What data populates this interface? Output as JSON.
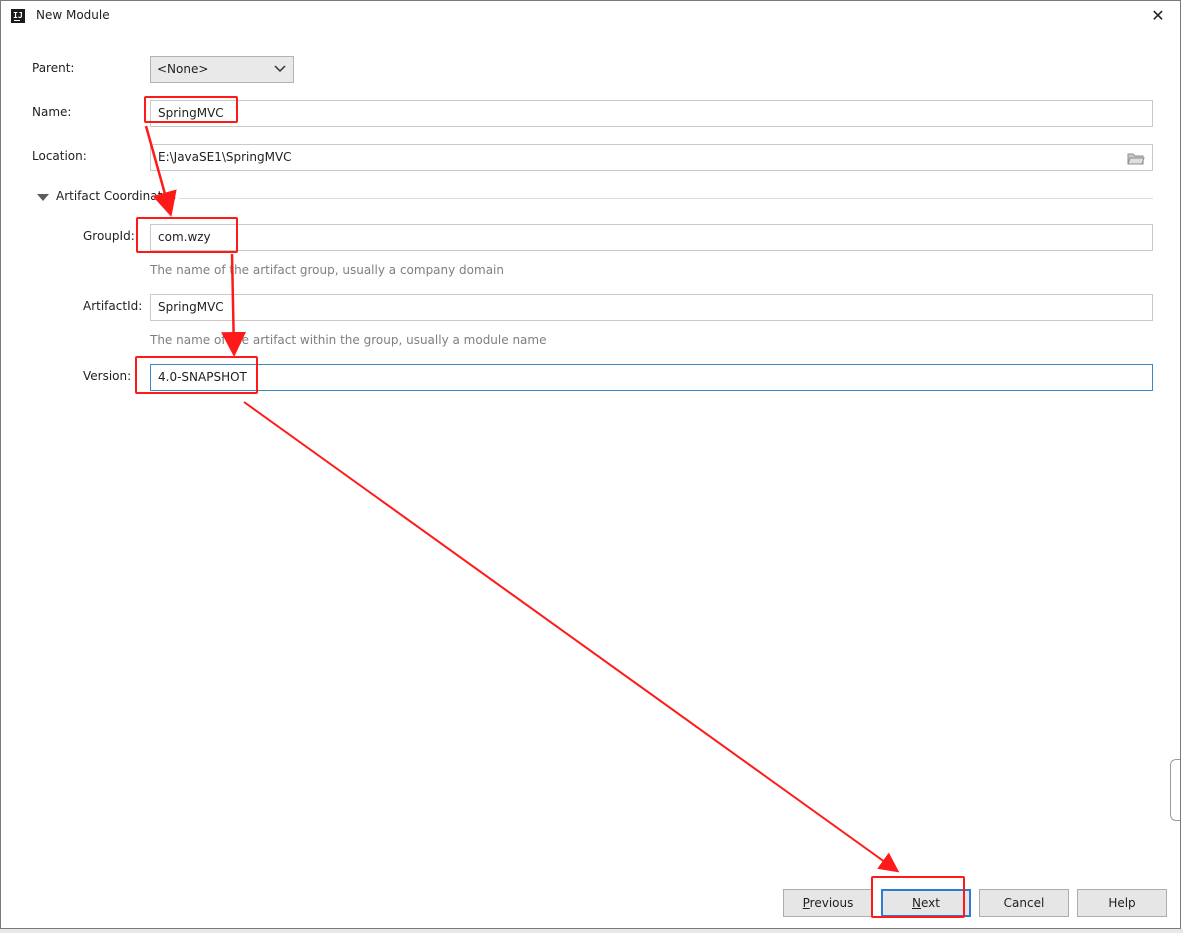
{
  "window": {
    "title": "New Module",
    "close_glyph": "✕",
    "app_icon_text": "IJ"
  },
  "form": {
    "parent": {
      "label": "Parent:",
      "value": "<None>"
    },
    "name": {
      "label": "Name:",
      "value": "SpringMVC"
    },
    "location": {
      "label": "Location:",
      "value": "E:\\JavaSE1\\SpringMVC"
    },
    "artifact_section": {
      "label": "Artifact Coordinates"
    },
    "group_id": {
      "label": "GroupId:",
      "value": "com.wzy",
      "hint": "The name of the artifact group, usually a company domain"
    },
    "artifact_id": {
      "label": "ArtifactId:",
      "value": "SpringMVC",
      "hint": "The name of the artifact within the group, usually a module name"
    },
    "version": {
      "label": "Version:",
      "value": "4.0-SNAPSHOT"
    }
  },
  "buttons": {
    "previous": {
      "mnemonic": "P",
      "rest": "revious"
    },
    "next": {
      "mnemonic": "N",
      "rest": "ext"
    },
    "cancel": "Cancel",
    "help": "Help"
  },
  "colors": {
    "annotation_red": "#ff1a1a",
    "focus_blue": "#3d87c3",
    "default_button_blue": "#2c7bd4"
  },
  "icons": {
    "combo": "chevron-down-icon",
    "browse": "folder-icon",
    "section": "triangle-down-icon",
    "close": "close-icon"
  }
}
